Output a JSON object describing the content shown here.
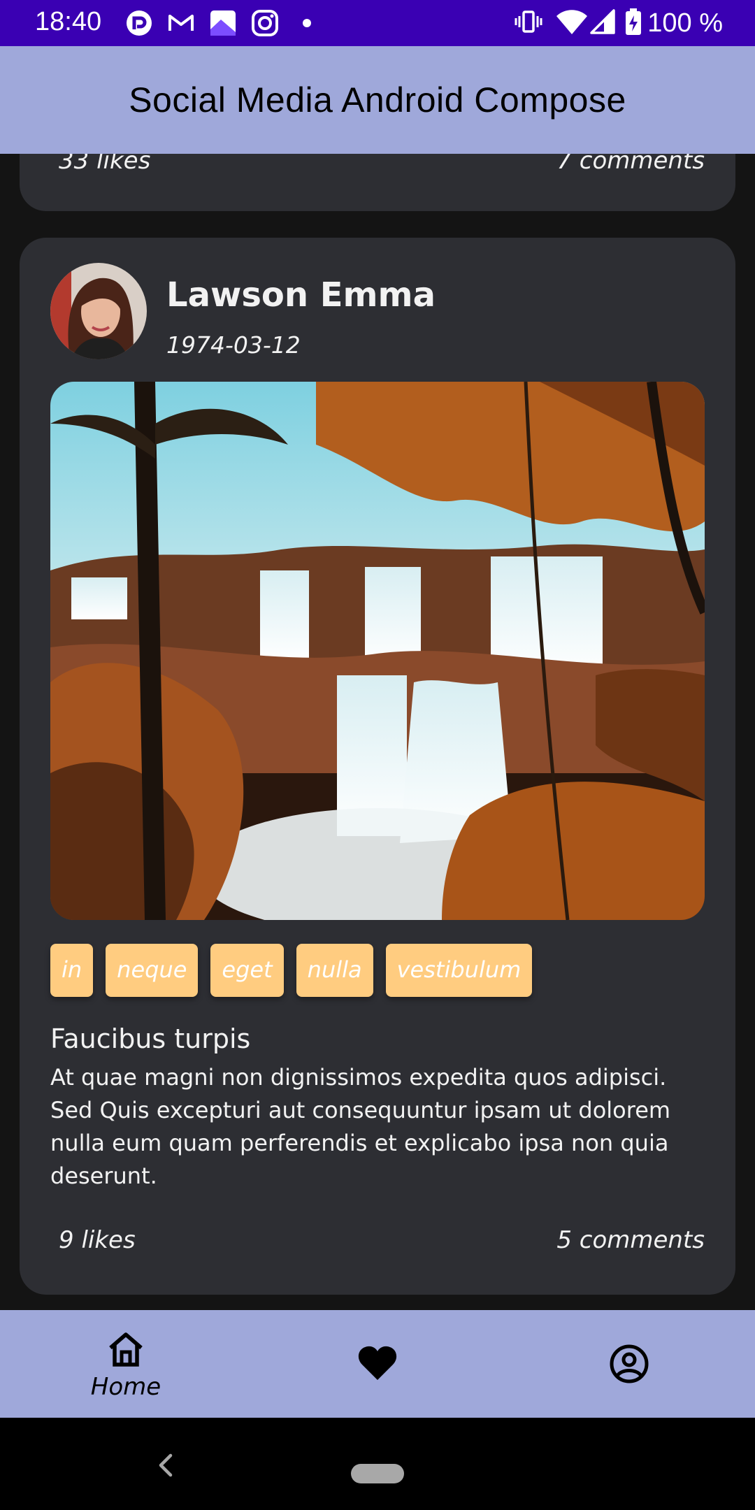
{
  "status_bar": {
    "time": "18:40",
    "battery": "100 %",
    "icons_left": [
      "app-notification-icon",
      "gmail-icon",
      "gallery-icon",
      "instagram-icon",
      "dot-icon"
    ],
    "icons_right": [
      "vibrate-icon",
      "wifi-icon",
      "signal-icon",
      "battery-charging-icon"
    ]
  },
  "app_bar": {
    "title": "Social Media Android Compose"
  },
  "previous_post": {
    "likes": "33 likes",
    "comments": "7 comments"
  },
  "post": {
    "author": "Lawson Emma",
    "date": "1974-03-12",
    "tags": [
      "in",
      "neque",
      "eget",
      "nulla",
      "vestibulum"
    ],
    "title": "Faucibus turpis",
    "body": "At quae magni non dignissimos expedita quos adipisci. Sed Quis excepturi aut consequuntur ipsam ut dolorem nulla eum quam perferendis et explicabo ipsa non quia deserunt.",
    "likes": "9 likes",
    "comments": "5 comments"
  },
  "bottom_nav": {
    "items": [
      {
        "label": "Home",
        "icon": "home-icon",
        "selected": true
      },
      {
        "label": "",
        "icon": "heart-icon",
        "selected": false
      },
      {
        "label": "",
        "icon": "account-circle-icon",
        "selected": false
      }
    ]
  },
  "colors": {
    "status_bar": "#3a00b3",
    "app_bar": "#9fa8da",
    "background": "#141414",
    "card": "#2d2e33",
    "tag": "#ffcc80"
  }
}
